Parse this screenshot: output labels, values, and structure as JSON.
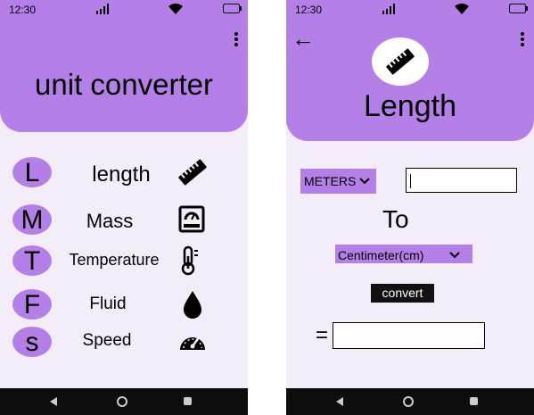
{
  "status_bar": {
    "time": "12:30"
  },
  "home": {
    "title": "unit converter",
    "menu_icon": "kebab-menu-icon",
    "units": [
      {
        "letter": "L",
        "label": "length",
        "icon": "ruler-icon"
      },
      {
        "letter": "M",
        "label": "Mass",
        "icon": "scale-icon"
      },
      {
        "letter": "T",
        "label": "Temperature",
        "icon": "thermometer-icon"
      },
      {
        "letter": "F",
        "label": "Fluid",
        "icon": "droplet-icon"
      },
      {
        "letter": "s",
        "label": "Speed",
        "icon": "speedometer-icon"
      }
    ]
  },
  "converter": {
    "back_icon": "←",
    "title": "Length",
    "from_unit": "METERS",
    "from_value": "",
    "to_label": "To",
    "to_unit": "Centimeter(cm)",
    "convert_label": "convert",
    "equals_label": "=",
    "result_value": ""
  },
  "colors": {
    "accent": "#b57fe8",
    "background": "#f3ecf9",
    "navbar": "#0d0d0d"
  }
}
